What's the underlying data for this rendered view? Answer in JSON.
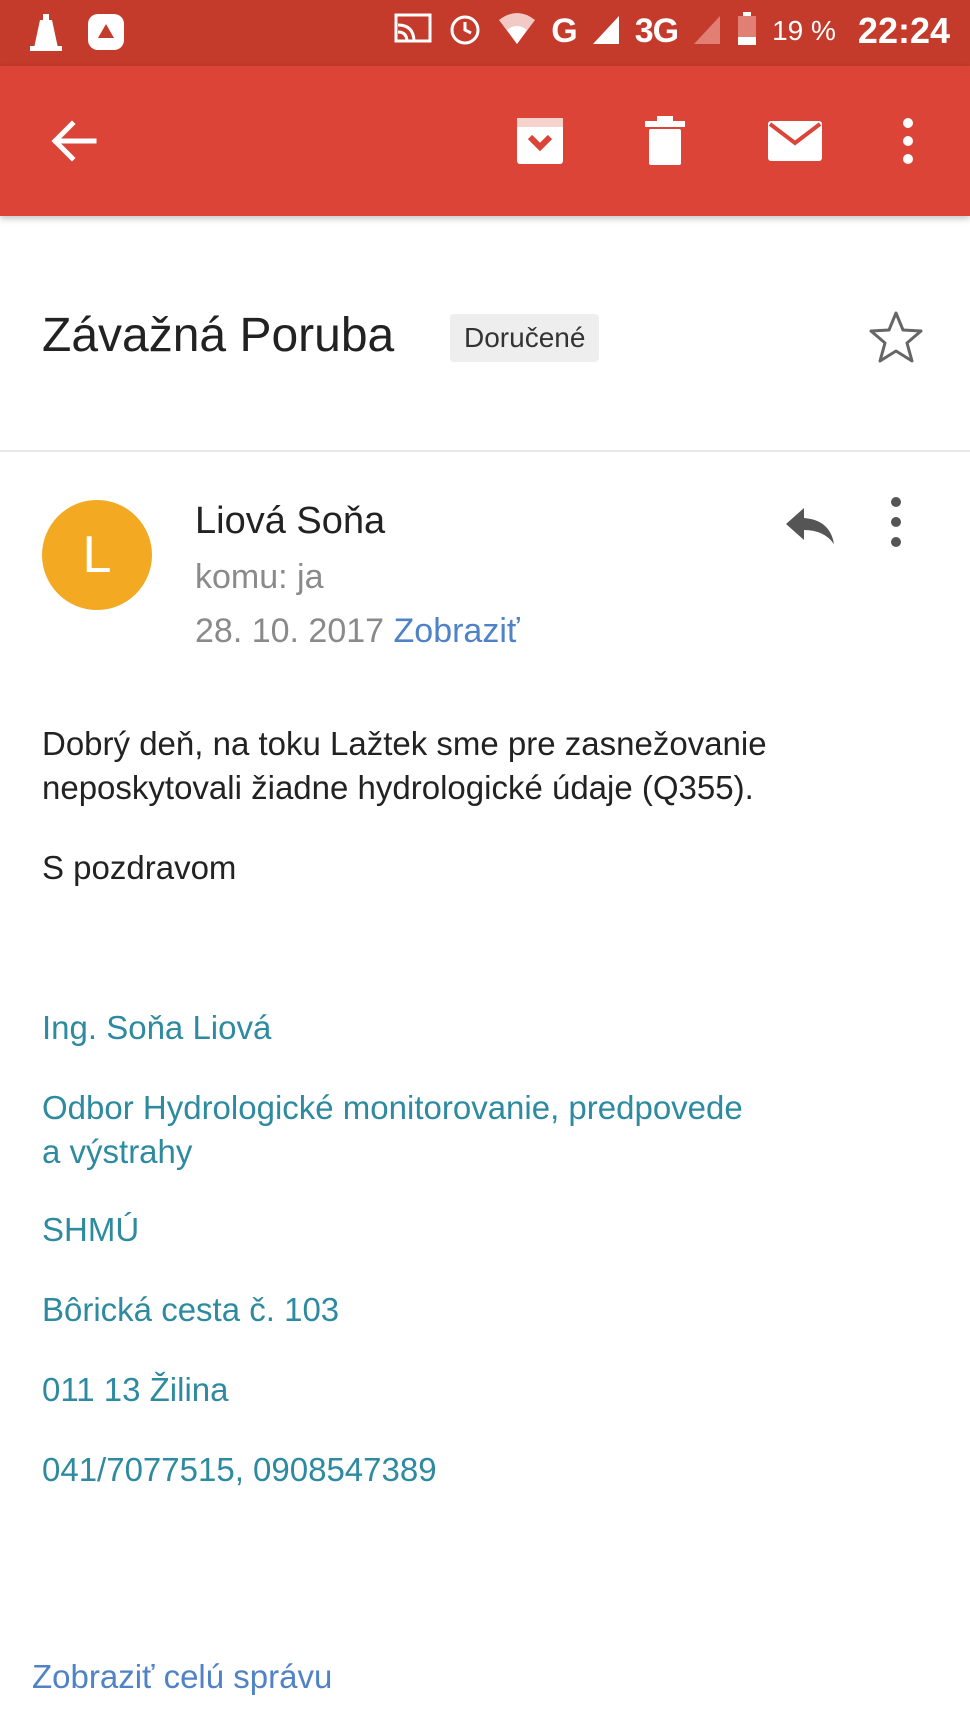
{
  "status_bar": {
    "network_label": "G",
    "network_3g": "3G",
    "battery": "19 %",
    "time": "22:24"
  },
  "email": {
    "subject": "Závažná Poruba",
    "label": "Doručené",
    "sender": "Liová Soňa",
    "avatar_letter": "L",
    "recipient": "komu: ja",
    "date": "28. 10. 2017",
    "details_link": "Zobraziť",
    "body": [
      "Dobrý deň, na toku Lažtek sme pre zasnežovanie",
      "neposkytovali žiadne hydrologické údaje (Q355).",
      "S pozdravom"
    ],
    "signature": {
      "name": "Ing. Soňa Liová",
      "department_line1": "Odbor Hydrologické monitorovanie, predpovede",
      "department_line2": "a výstrahy",
      "org": "SHMÚ",
      "street": "Bôrická cesta č. 103",
      "city": "011 13  Žilina",
      "phone": "041/7077515, 0908547389"
    },
    "show_full": "Zobraziť celú správu"
  },
  "colors": {
    "status_bar": "#c43a2b",
    "app_bar": "#db4437",
    "avatar": "#f4a922",
    "link": "#4f82c6",
    "signature": "#2d8aa0"
  }
}
